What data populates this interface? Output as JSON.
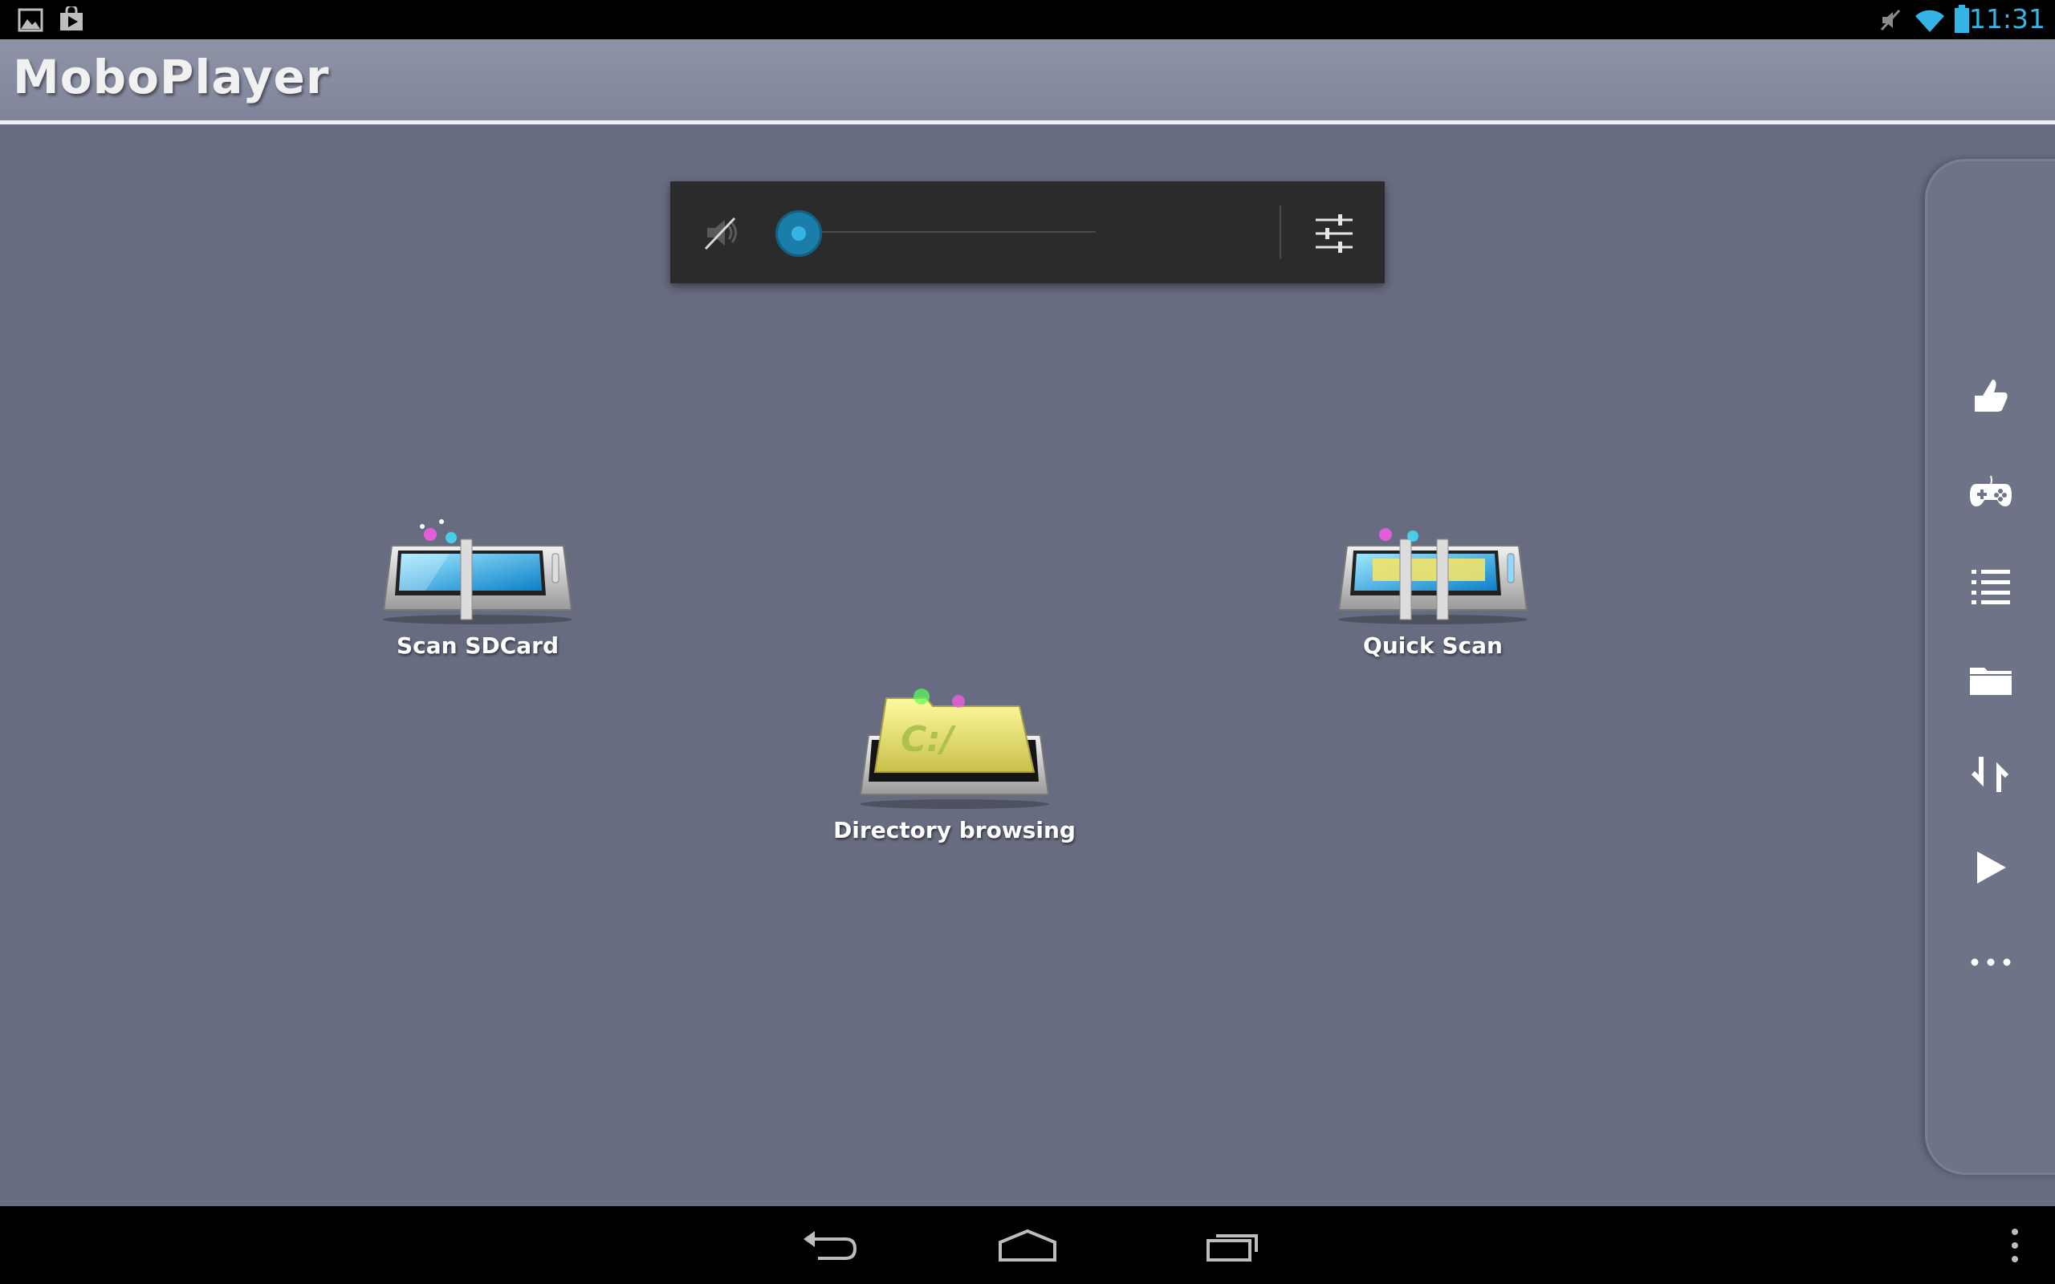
{
  "status_bar": {
    "left_icons": [
      "picture-notification-icon",
      "play-store-notification-icon"
    ],
    "right_icons": [
      "mute-status-icon",
      "wifi-icon",
      "battery-icon"
    ],
    "time": "11:31",
    "accent_color": "#35b4e6"
  },
  "action_bar": {
    "title": "MoboPlayer"
  },
  "volume_panel": {
    "muted": true,
    "level": 0,
    "mute_icon": "speaker-muted-icon",
    "settings_icon": "equalizer-sliders-icon",
    "thumb_color": "#35b4e6"
  },
  "launchers": [
    {
      "label": "Scan SDCard",
      "icon": "scan-sdcard-icon"
    },
    {
      "label": "Directory browsing",
      "icon": "directory-folder-icon"
    },
    {
      "label": "Quick Scan",
      "icon": "quick-scan-icon"
    }
  ],
  "side_rail": {
    "items": [
      "thumbs-up-icon",
      "gamepad-icon",
      "list-icon",
      "folder-icon",
      "sort-arrows-icon",
      "play-icon",
      "more-dots-icon"
    ]
  },
  "nav_bar": {
    "items": [
      "back-icon",
      "home-icon",
      "recent-apps-icon",
      "overflow-menu-icon"
    ]
  }
}
